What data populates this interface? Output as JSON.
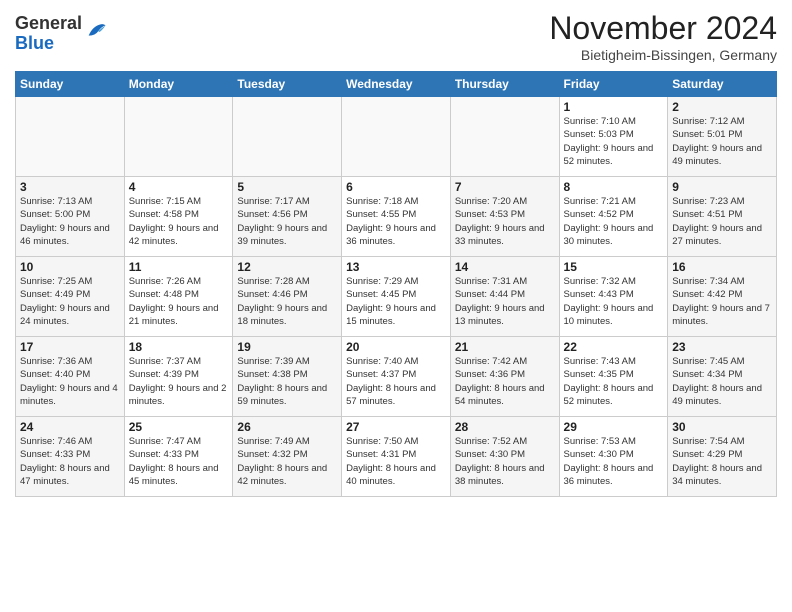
{
  "header": {
    "logo_general": "General",
    "logo_blue": "Blue",
    "month_title": "November 2024",
    "location": "Bietigheim-Bissingen, Germany"
  },
  "days_of_week": [
    "Sunday",
    "Monday",
    "Tuesday",
    "Wednesday",
    "Thursday",
    "Friday",
    "Saturday"
  ],
  "weeks": [
    [
      {
        "day": "",
        "info": ""
      },
      {
        "day": "",
        "info": ""
      },
      {
        "day": "",
        "info": ""
      },
      {
        "day": "",
        "info": ""
      },
      {
        "day": "",
        "info": ""
      },
      {
        "day": "1",
        "info": "Sunrise: 7:10 AM\nSunset: 5:03 PM\nDaylight: 9 hours and 52 minutes."
      },
      {
        "day": "2",
        "info": "Sunrise: 7:12 AM\nSunset: 5:01 PM\nDaylight: 9 hours and 49 minutes."
      }
    ],
    [
      {
        "day": "3",
        "info": "Sunrise: 7:13 AM\nSunset: 5:00 PM\nDaylight: 9 hours and 46 minutes."
      },
      {
        "day": "4",
        "info": "Sunrise: 7:15 AM\nSunset: 4:58 PM\nDaylight: 9 hours and 42 minutes."
      },
      {
        "day": "5",
        "info": "Sunrise: 7:17 AM\nSunset: 4:56 PM\nDaylight: 9 hours and 39 minutes."
      },
      {
        "day": "6",
        "info": "Sunrise: 7:18 AM\nSunset: 4:55 PM\nDaylight: 9 hours and 36 minutes."
      },
      {
        "day": "7",
        "info": "Sunrise: 7:20 AM\nSunset: 4:53 PM\nDaylight: 9 hours and 33 minutes."
      },
      {
        "day": "8",
        "info": "Sunrise: 7:21 AM\nSunset: 4:52 PM\nDaylight: 9 hours and 30 minutes."
      },
      {
        "day": "9",
        "info": "Sunrise: 7:23 AM\nSunset: 4:51 PM\nDaylight: 9 hours and 27 minutes."
      }
    ],
    [
      {
        "day": "10",
        "info": "Sunrise: 7:25 AM\nSunset: 4:49 PM\nDaylight: 9 hours and 24 minutes."
      },
      {
        "day": "11",
        "info": "Sunrise: 7:26 AM\nSunset: 4:48 PM\nDaylight: 9 hours and 21 minutes."
      },
      {
        "day": "12",
        "info": "Sunrise: 7:28 AM\nSunset: 4:46 PM\nDaylight: 9 hours and 18 minutes."
      },
      {
        "day": "13",
        "info": "Sunrise: 7:29 AM\nSunset: 4:45 PM\nDaylight: 9 hours and 15 minutes."
      },
      {
        "day": "14",
        "info": "Sunrise: 7:31 AM\nSunset: 4:44 PM\nDaylight: 9 hours and 13 minutes."
      },
      {
        "day": "15",
        "info": "Sunrise: 7:32 AM\nSunset: 4:43 PM\nDaylight: 9 hours and 10 minutes."
      },
      {
        "day": "16",
        "info": "Sunrise: 7:34 AM\nSunset: 4:42 PM\nDaylight: 9 hours and 7 minutes."
      }
    ],
    [
      {
        "day": "17",
        "info": "Sunrise: 7:36 AM\nSunset: 4:40 PM\nDaylight: 9 hours and 4 minutes."
      },
      {
        "day": "18",
        "info": "Sunrise: 7:37 AM\nSunset: 4:39 PM\nDaylight: 9 hours and 2 minutes."
      },
      {
        "day": "19",
        "info": "Sunrise: 7:39 AM\nSunset: 4:38 PM\nDaylight: 8 hours and 59 minutes."
      },
      {
        "day": "20",
        "info": "Sunrise: 7:40 AM\nSunset: 4:37 PM\nDaylight: 8 hours and 57 minutes."
      },
      {
        "day": "21",
        "info": "Sunrise: 7:42 AM\nSunset: 4:36 PM\nDaylight: 8 hours and 54 minutes."
      },
      {
        "day": "22",
        "info": "Sunrise: 7:43 AM\nSunset: 4:35 PM\nDaylight: 8 hours and 52 minutes."
      },
      {
        "day": "23",
        "info": "Sunrise: 7:45 AM\nSunset: 4:34 PM\nDaylight: 8 hours and 49 minutes."
      }
    ],
    [
      {
        "day": "24",
        "info": "Sunrise: 7:46 AM\nSunset: 4:33 PM\nDaylight: 8 hours and 47 minutes."
      },
      {
        "day": "25",
        "info": "Sunrise: 7:47 AM\nSunset: 4:33 PM\nDaylight: 8 hours and 45 minutes."
      },
      {
        "day": "26",
        "info": "Sunrise: 7:49 AM\nSunset: 4:32 PM\nDaylight: 8 hours and 42 minutes."
      },
      {
        "day": "27",
        "info": "Sunrise: 7:50 AM\nSunset: 4:31 PM\nDaylight: 8 hours and 40 minutes."
      },
      {
        "day": "28",
        "info": "Sunrise: 7:52 AM\nSunset: 4:30 PM\nDaylight: 8 hours and 38 minutes."
      },
      {
        "day": "29",
        "info": "Sunrise: 7:53 AM\nSunset: 4:30 PM\nDaylight: 8 hours and 36 minutes."
      },
      {
        "day": "30",
        "info": "Sunrise: 7:54 AM\nSunset: 4:29 PM\nDaylight: 8 hours and 34 minutes."
      }
    ]
  ]
}
